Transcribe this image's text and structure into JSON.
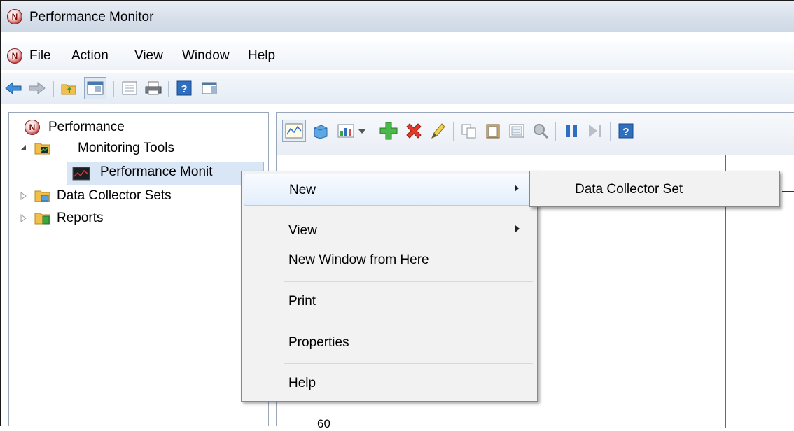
{
  "window": {
    "title": "Performance Monitor"
  },
  "menubar": {
    "items": [
      "File",
      "Action",
      "View",
      "Window",
      "Help"
    ]
  },
  "toolbar": {
    "icons": [
      "back-arrow-icon",
      "forward-arrow-icon",
      "up-folder-icon",
      "show-hide-tree-icon",
      "export-list-icon",
      "print-icon",
      "help-icon",
      "action-pane-icon"
    ]
  },
  "tree": {
    "items": [
      {
        "label": "Performance"
      },
      {
        "label": "Monitoring Tools"
      },
      {
        "label": "Performance Monit"
      },
      {
        "label": "Data Collector Sets"
      },
      {
        "label": "Reports"
      }
    ]
  },
  "graph_toolbar": {
    "icons": [
      "view-graph-icon",
      "view-histogram-icon",
      "change-graph-type-icon",
      "add-counter-icon",
      "delete-counter-icon",
      "highlight-icon",
      "copy-properties-icon",
      "paste-counter-list-icon",
      "properties-icon",
      "zoom-icon",
      "freeze-display-icon",
      "update-data-icon",
      "help-icon"
    ]
  },
  "graph": {
    "y_tick_label": "60",
    "accent_line_color": "#d03a4e"
  },
  "context_menu": {
    "items": [
      {
        "label": "New",
        "has_submenu": true,
        "highlighted": true
      },
      {
        "label": "View",
        "has_submenu": true
      },
      {
        "label": "New Window from Here"
      },
      {
        "label": "Print"
      },
      {
        "label": "Properties"
      },
      {
        "label": "Help"
      }
    ]
  },
  "submenu": {
    "items": [
      {
        "label": "Data Collector Set"
      }
    ]
  }
}
